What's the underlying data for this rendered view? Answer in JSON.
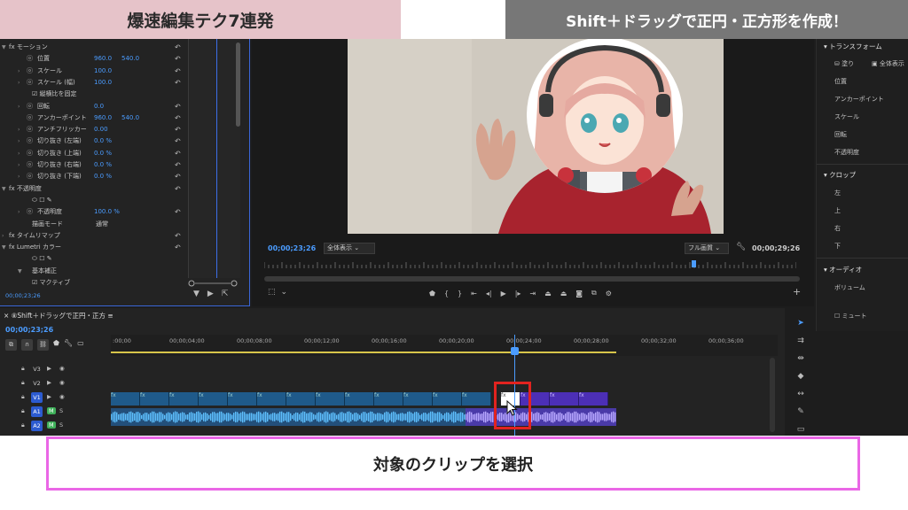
{
  "banners": {
    "left_title": "爆速編集テク7連発",
    "right_title": "Shift＋ドラッグで正円・正方形を作成！"
  },
  "effect_controls": {
    "rows": [
      {
        "arrow": "▼",
        "label": "fx モーション",
        "v1": "",
        "v2": "",
        "stop": ""
      },
      {
        "arrow": "",
        "label": "位置",
        "v1": "960.0",
        "v2": "540.0",
        "stop": "ⓞ"
      },
      {
        "arrow": "›",
        "label": "スケール",
        "v1": "100.0",
        "v2": "",
        "stop": "ⓞ"
      },
      {
        "arrow": "›",
        "label": "スケール (幅)",
        "v1": "100.0",
        "v2": "",
        "stop": "ⓞ"
      },
      {
        "arrow": "",
        "label": "☑ 縦横比を固定",
        "v1": "",
        "v2": "",
        "stop": ""
      },
      {
        "arrow": "›",
        "label": "回転",
        "v1": "0.0",
        "v2": "",
        "stop": "ⓞ"
      },
      {
        "arrow": "",
        "label": "アンカーポイント",
        "v1": "960.0",
        "v2": "540.0",
        "stop": "ⓞ"
      },
      {
        "arrow": "›",
        "label": "アンチフリッカー",
        "v1": "0.00",
        "v2": "",
        "stop": "ⓞ"
      },
      {
        "arrow": "›",
        "label": "切り抜き (左端)",
        "v1": "0.0 %",
        "v2": "",
        "stop": "ⓞ"
      },
      {
        "arrow": "›",
        "label": "切り抜き (上端)",
        "v1": "0.0 %",
        "v2": "",
        "stop": "ⓞ"
      },
      {
        "arrow": "›",
        "label": "切り抜き (右端)",
        "v1": "0.0 %",
        "v2": "",
        "stop": "ⓞ"
      },
      {
        "arrow": "›",
        "label": "切り抜き (下端)",
        "v1": "0.0 %",
        "v2": "",
        "stop": "ⓞ"
      },
      {
        "arrow": "▼",
        "label": "fx 不透明度",
        "v1": "",
        "v2": "",
        "stop": ""
      },
      {
        "arrow": "",
        "label": "⬭ ☐ ✎",
        "v1": "",
        "v2": "",
        "stop": ""
      },
      {
        "arrow": "›",
        "label": "不透明度",
        "v1": "100.0 %",
        "v2": "",
        "stop": "ⓞ"
      },
      {
        "arrow": "",
        "label": "描画モード",
        "v1": "通常",
        "v2": "",
        "stop": ""
      },
      {
        "arrow": "›",
        "label": "fx タイムリマップ",
        "v1": "",
        "v2": "",
        "stop": ""
      },
      {
        "arrow": "▼",
        "label": "fx Lumetri カラー",
        "v1": "",
        "v2": "",
        "stop": ""
      },
      {
        "arrow": "",
        "label": "⬭ ☐ ✎",
        "v1": "",
        "v2": "",
        "stop": ""
      },
      {
        "arrow": "▼",
        "label": "基本補正",
        "v1": "",
        "v2": "",
        "stop": ""
      },
      {
        "arrow": "",
        "label": "☑ マクティブ",
        "v1": "",
        "v2": "",
        "stop": ""
      }
    ],
    "timecode": "00;00;23;26"
  },
  "monitor": {
    "timecode_left": "00;00;23;26",
    "zoom_label": "全体表示",
    "quality_label": "フル画質",
    "timecode_right": "00;00;29;26"
  },
  "essential_graphics": {
    "transform_header": "トランスフォーム",
    "fill_label": "塗り",
    "fullscreen_label": "全体表示",
    "position": "位置",
    "anchor": "アンカーポイント",
    "scale": "スケール",
    "rotation": "回転",
    "opacity": "不透明度",
    "crop_header": "クロップ",
    "crop_left": "左",
    "crop_top": "上",
    "crop_right": "右",
    "crop_bottom": "下",
    "audio_header": "オーディオ",
    "volume": "ボリューム",
    "mute": "ミュート"
  },
  "timeline": {
    "tab_label": "×  ⑧Shift＋ドラッグで正円・正方 ≡",
    "timecode": "00;00;23;26",
    "ruler_labels": [
      ":00;00",
      "00;00;04;00",
      "00;00;08;00",
      "00;00;12;00",
      "00;00;16;00",
      "00;00;20;00",
      "00;00;24;00",
      "00;00;28;00",
      "00;00;32;00",
      "00;00;36;00"
    ],
    "tracks": [
      {
        "name": "V3",
        "active": false
      },
      {
        "name": "V2",
        "active": false
      },
      {
        "name": "V1",
        "active": true
      },
      {
        "name": "A1",
        "active": true
      },
      {
        "name": "A2",
        "active": true
      }
    ]
  },
  "caption": "対象のクリップを選択",
  "colors": {
    "accent": "#4b9cff",
    "highlight": "#e2231f",
    "caption_border": "#ea67e6",
    "left_banner": "#e6c3c9",
    "right_banner": "#777777"
  }
}
